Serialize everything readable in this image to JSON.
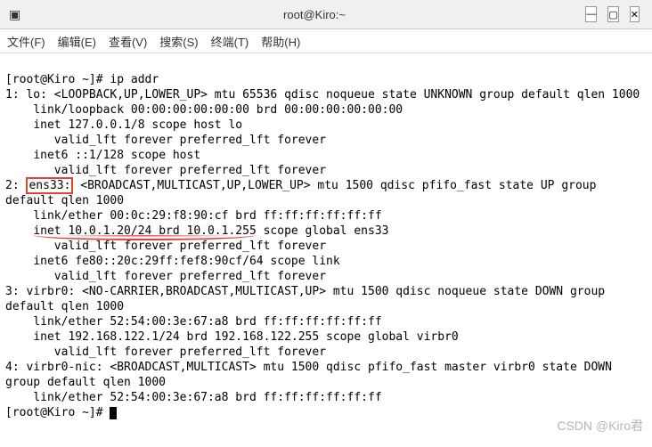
{
  "window": {
    "title": "root@Kiro:~",
    "min": "—",
    "max": "▢",
    "close": "✕"
  },
  "menu": {
    "file": "文件(F)",
    "edit": "编辑(E)",
    "view": "查看(V)",
    "search": "搜索(S)",
    "terminal": "终端(T)",
    "help": "帮助(H)"
  },
  "term": {
    "prompt1": "[root@Kiro ~]# ",
    "cmd1": "ip addr",
    "lo_line": "1: lo: <LOOPBACK,UP,LOWER_UP> mtu 65536 qdisc noqueue state UNKNOWN group default qlen 1000",
    "lo_link": "    link/loopback 00:00:00:00:00:00 brd 00:00:00:00:00:00",
    "lo_inet": "    inet 127.0.0.1/8 scope host lo",
    "lo_valid": "       valid_lft forever preferred_lft forever",
    "lo_inet6": "    inet6 ::1/128 scope host",
    "lo_valid2": "       valid_lft forever preferred_lft forever",
    "ens_pre": "2: ",
    "ens_label": "ens33:",
    "ens_rest": " <BROADCAST,MULTICAST,UP,LOWER_UP> mtu 1500 qdisc pfifo_fast state UP group default qlen 1000",
    "ens_link": "    link/ether 00:0c:29:f8:90:cf brd ff:ff:ff:ff:ff:ff",
    "ens_inet_pre": "    ",
    "ens_inet_ul": "inet 10.0.1.20/24 brd 10.0.1.255",
    "ens_inet_post": " scope global ens33",
    "ens_valid": "       valid_lft forever preferred_lft forever",
    "ens_inet6": "    inet6 fe80::20c:29ff:fef8:90cf/64 scope link",
    "ens_valid2": "       valid_lft forever preferred_lft forever",
    "vb_line": "3: virbr0: <NO-CARRIER,BROADCAST,MULTICAST,UP> mtu 1500 qdisc noqueue state DOWN group default qlen 1000",
    "vb_link": "    link/ether 52:54:00:3e:67:a8 brd ff:ff:ff:ff:ff:ff",
    "vb_inet": "    inet 192.168.122.1/24 brd 192.168.122.255 scope global virbr0",
    "vb_valid": "       valid_lft forever preferred_lft forever",
    "vbn_line": "4: virbr0-nic: <BROADCAST,MULTICAST> mtu 1500 qdisc pfifo_fast master virbr0 state DOWN group default qlen 1000",
    "vbn_link": "    link/ether 52:54:00:3e:67:a8 brd ff:ff:ff:ff:ff:ff",
    "prompt2": "[root@Kiro ~]# "
  },
  "watermark": "CSDN @Kiro君"
}
